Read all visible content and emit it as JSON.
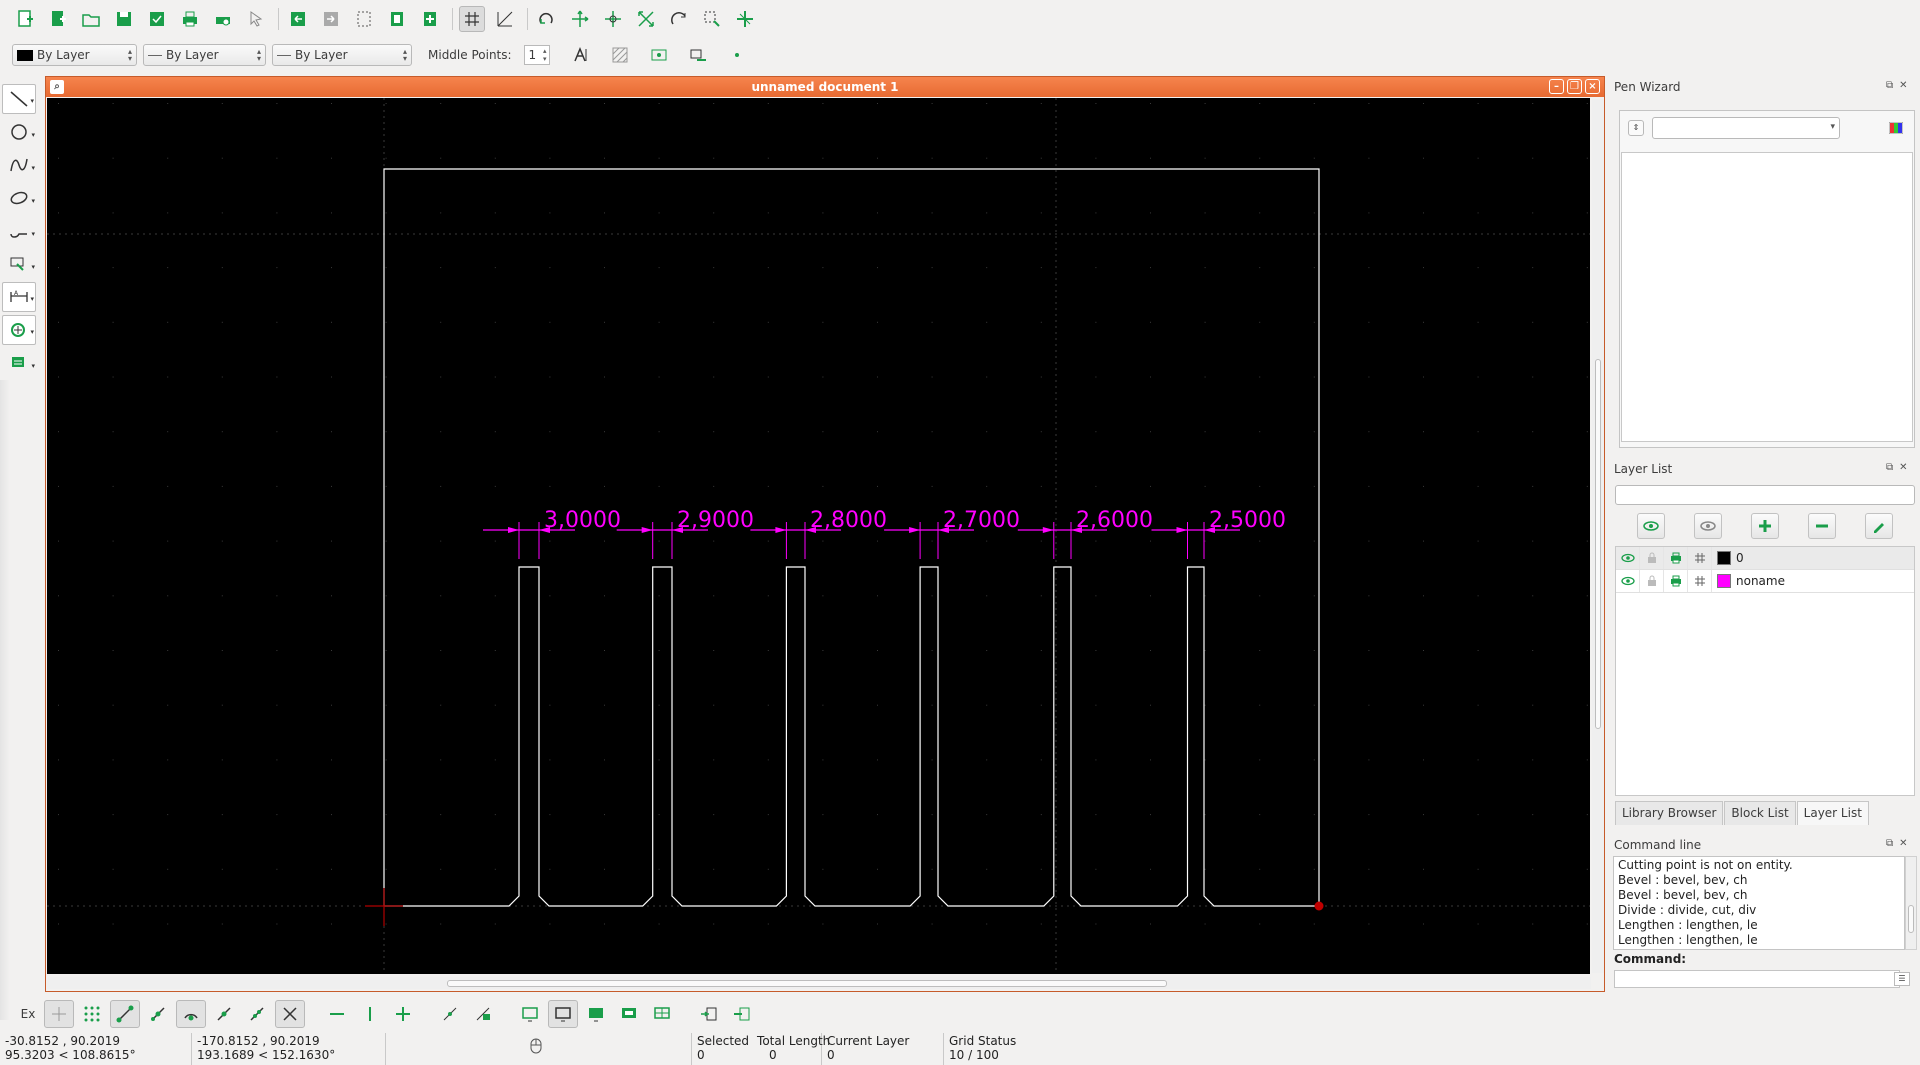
{
  "doc_title": "unnamed document 1",
  "pen": {
    "color": "By Layer",
    "width": "By Layer",
    "linetype": "By Layer"
  },
  "middle_points": {
    "label": "Middle Points:",
    "value": "1"
  },
  "dims": [
    "3,0000",
    "2,9000",
    "2,8000",
    "2,7000",
    "2,6000",
    "2,5000"
  ],
  "pen_wizard": {
    "title": "Pen Wizard"
  },
  "layer_list": {
    "title": "Layer List",
    "layers": [
      {
        "name": "0",
        "color": "#000000"
      },
      {
        "name": "noname",
        "color": "#ff00ff"
      }
    ]
  },
  "dock_tabs": [
    "Library Browser",
    "Block List",
    "Layer List"
  ],
  "command_line": {
    "title": "Command line",
    "history": [
      "Cutting point is not on entity.",
      "Bevel : bevel, bev, ch",
      "Bevel : bevel, bev, ch",
      "Divide : divide, cut, div",
      "Lengthen : lengthen, le",
      "Lengthen : lengthen, le"
    ],
    "label": "Command:"
  },
  "snap": {
    "exclusive": "Ex"
  },
  "status": {
    "abs_coord": "-30.8152 , 90.2019",
    "abs_polar": "95.3203 < 108.8615°",
    "rel_coord": "-170.8152 , 90.2019",
    "rel_polar": "193.1689 < 152.1630°",
    "selected_label": "Selected",
    "selected_value": "0",
    "total_length_label": "Total Length",
    "total_length_value": "0",
    "current_layer_label": "Current Layer",
    "current_layer_value": "0",
    "grid_label": "Grid Status",
    "grid_value": "10 / 100"
  },
  "colors": {
    "accent": "#e76a32",
    "dimension": "#ff00ff",
    "geometry": "#ffffff",
    "icon_green": "#1a9e4a"
  }
}
